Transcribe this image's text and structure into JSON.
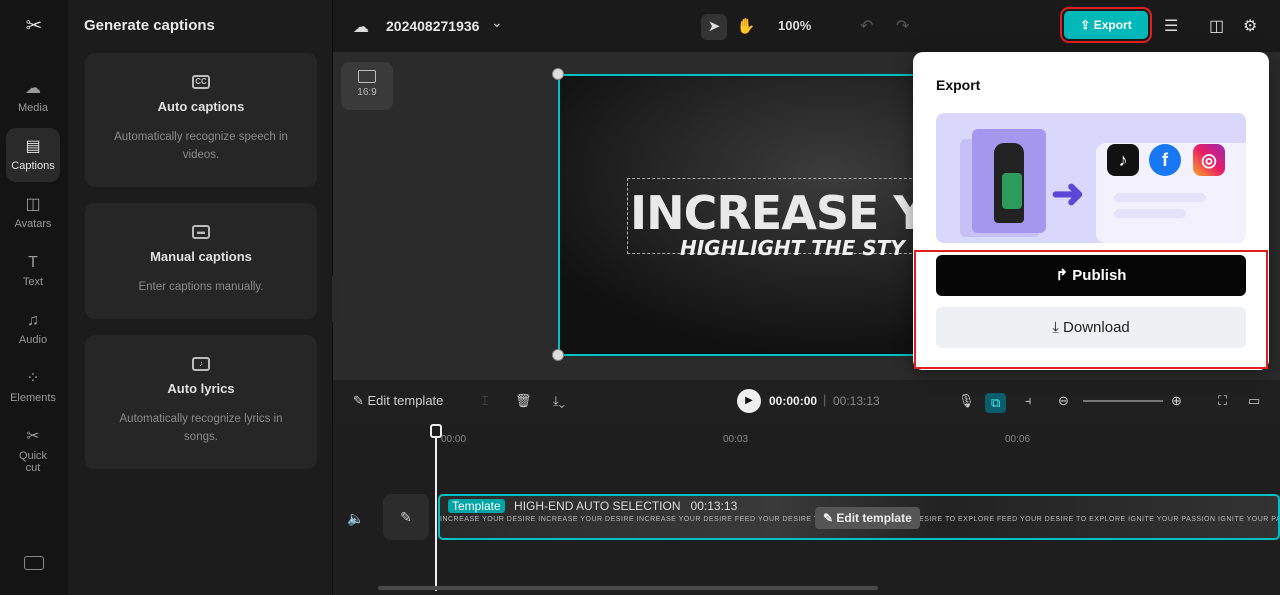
{
  "app": {
    "title": "CapCut editor"
  },
  "rail": {
    "items": [
      {
        "label": "Media",
        "icon": "☁"
      },
      {
        "label": "Captions",
        "icon": "▤"
      },
      {
        "label": "Avatars",
        "icon": "◫"
      },
      {
        "label": "Text",
        "icon": "T"
      },
      {
        "label": "Audio",
        "icon": "♫"
      },
      {
        "label": "Elements",
        "icon": "⁘"
      },
      {
        "label": "Quick",
        "label2": "cut",
        "icon": "✂"
      }
    ]
  },
  "panel": {
    "title": "Generate captions",
    "cards": [
      {
        "title": "Auto captions",
        "desc": "Automatically recognize speech in videos.",
        "icon": "CC"
      },
      {
        "title": "Manual captions",
        "desc": "Enter captions manually.",
        "icon": "▬"
      },
      {
        "title": "Auto lyrics",
        "desc": "Automatically recognize lyrics in songs.",
        "icon": "♪"
      }
    ]
  },
  "topbar": {
    "project_name": "202408271936",
    "zoom": "100%",
    "export_label": "Export"
  },
  "canvas": {
    "ratio": "16:9",
    "video_title": "INCREASE YOUR D",
    "video_subtitle": "HIGHLIGHT THE STY"
  },
  "timeline": {
    "edit_template": "Edit template",
    "current_time": "00:00:00",
    "duration": "00:13:13",
    "ticks": [
      "00:00",
      "00:03",
      "00:06"
    ],
    "clip_tag": "Template",
    "clip_name": "HIGH-END AUTO SELECTION",
    "clip_duration": "00:13:13",
    "clip_thumbs": "INCREASE YOUR DESIRE     INCREASE YOUR DESIRE     INCREASE YOUR DESIRE     FEED YOUR DESIRE TO EXPLORE     FEED YOUR DESIRE TO EXPLORE     FEED YOUR DESIRE TO EXPLORE     IGNITE YOUR PASSION     IGNITE YOUR PASSION     IGNITE YOUR PASSION",
    "clip_edit": "Edit template"
  },
  "export_popup": {
    "title": "Export",
    "publish_label": "Publish",
    "download_label": "Download"
  }
}
